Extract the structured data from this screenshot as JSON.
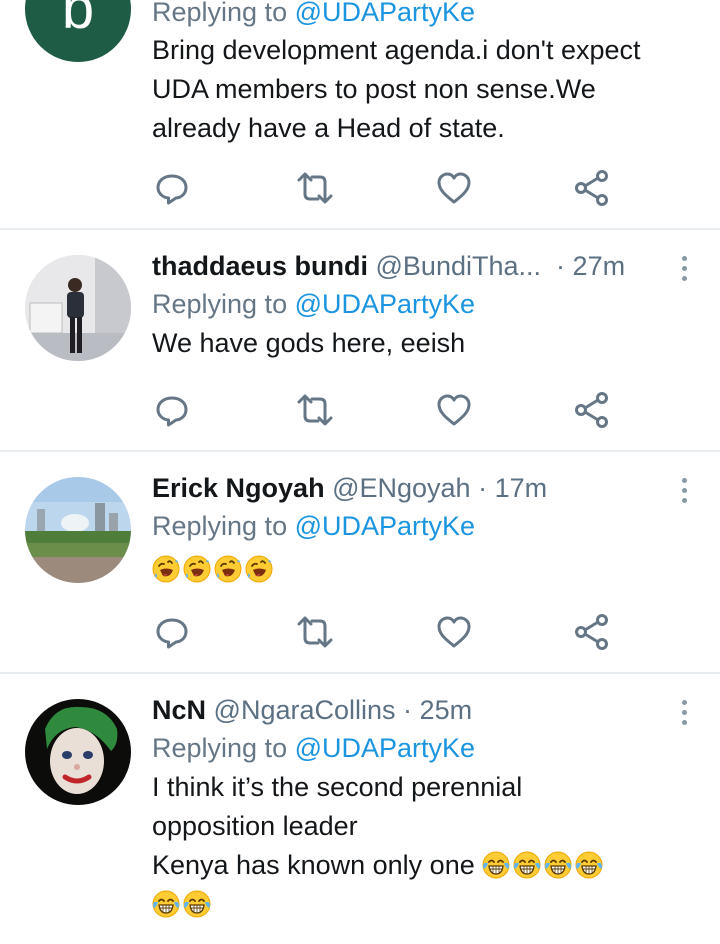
{
  "colors": {
    "accent": "#1b95e0",
    "muted": "#657786",
    "text": "#14171a",
    "divider": "#e6ecf0"
  },
  "tweets": [
    {
      "avatar_letter": "b",
      "replying_label": "Replying to",
      "replying_to": "@UDAPartyKe",
      "text_lines": [
        "Bring development agenda.i don't expect",
        "UDA members to post non sense.We",
        "already have a Head of state."
      ]
    },
    {
      "name": "thaddaeus bundi",
      "handle": "@BundiTha...",
      "time": "27m",
      "replying_label": "Replying to",
      "replying_to": "@UDAPartyKe",
      "text_lines": [
        "We have gods here, eeish"
      ]
    },
    {
      "name": "Erick Ngoyah",
      "handle": "@ENgoyah",
      "time": "17m",
      "replying_label": "Replying to",
      "replying_to": "@UDAPartyKe",
      "emoji": [
        "rolling-on-floor-laughing",
        "rolling-on-floor-laughing",
        "rolling-on-floor-laughing",
        "rolling-on-floor-laughing"
      ]
    },
    {
      "name": "NcN",
      "handle": "@NgaraCollins",
      "time": "25m",
      "replying_label": "Replying to",
      "replying_to": "@UDAPartyKe",
      "text_lines": [
        "I think it’s the second perennial",
        "opposition leader",
        "Kenya has known only one"
      ],
      "emoji": [
        "tears-of-joy",
        "tears-of-joy",
        "tears-of-joy",
        "tears-of-joy",
        "tears-of-joy",
        "tears-of-joy"
      ]
    }
  ],
  "icons": {
    "reply": "reply-icon",
    "retweet": "retweet-icon",
    "like": "like-icon",
    "share": "share-icon",
    "more": "more-icon"
  }
}
